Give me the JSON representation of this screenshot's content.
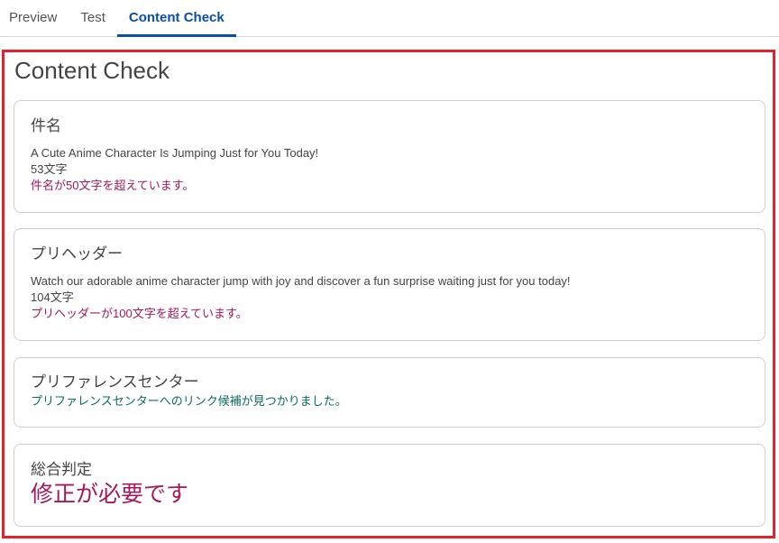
{
  "tabs": [
    {
      "label": "Preview",
      "active": false
    },
    {
      "label": "Test",
      "active": false
    },
    {
      "label": "Content Check",
      "active": true
    }
  ],
  "panel": {
    "title": "Content Check",
    "border_color": "#e1222f"
  },
  "subject": {
    "heading": "件名",
    "text": "A Cute Anime Character Is Jumping Just for You Today!",
    "count": "53文字",
    "warning": "件名が50文字を超えています。"
  },
  "preheader": {
    "heading": "プリヘッダー",
    "text": "Watch our adorable anime character jump with joy and discover a fun surprise waiting just for you today!",
    "count": "104文字",
    "warning": "プリヘッダーが100文字を超えています。"
  },
  "preference_center": {
    "heading": "プリファレンスセンター",
    "message": "プリファレンスセンターへのリンク候補が見つかりました。"
  },
  "overall": {
    "heading": "総合判定",
    "verdict": "修正が必要です"
  },
  "colors": {
    "accent": "#0b4fa3",
    "warning": "#a3195b",
    "success": "#0c6b5e"
  }
}
